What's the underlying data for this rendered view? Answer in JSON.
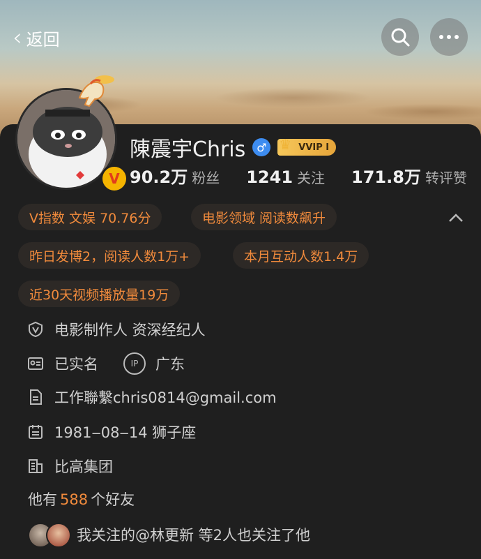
{
  "header": {
    "back_label": "返回",
    "back_icon": "chevron-left-icon",
    "search_icon": "search-icon",
    "more_icon": "more-dots-icon"
  },
  "profile": {
    "name": "陳震宇Chris",
    "vip_label": "VVIP Ⅰ",
    "verified_badge": "V",
    "gender_symbol": "♂",
    "stats": [
      {
        "value": "90.2万",
        "label": "粉丝"
      },
      {
        "value": "1241",
        "label": "关注"
      },
      {
        "value": "171.8万",
        "label": "转评赞"
      }
    ]
  },
  "tags": [
    "V指数 文娱 70.76分",
    "电影领域 阅读数飙升",
    "昨日发博2，阅读人数1万+",
    "本月互动人数1.4万",
    "近30天视频播放量19万"
  ],
  "info": {
    "occupation": "电影制作人 资深经纪人",
    "real_name": "已实名",
    "ip_badge": "IP",
    "location": "广东",
    "contact": "工作聯繫chris0814@gmail.com",
    "birthday": "1981‒08‒14 狮子座",
    "company": "比高集团"
  },
  "friends": {
    "prefix": "他有",
    "count": "588",
    "suffix": "个好友"
  },
  "mutual_follow": "我关注的@林更新 等2人也关注了他",
  "colors": {
    "accent_orange": "#f08a3c",
    "background": "#1f1f1f",
    "tag_bg": "#2d2926"
  }
}
